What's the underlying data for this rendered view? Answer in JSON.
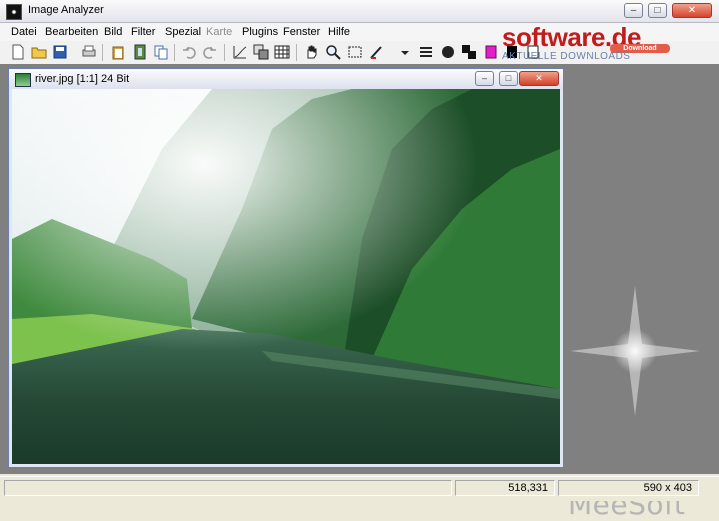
{
  "window": {
    "title": "Image Analyzer"
  },
  "menu": [
    "Datei",
    "Bearbeiten",
    "Bild",
    "Filter",
    "Spezial",
    "Karte",
    "Plugins",
    "Fenster",
    "Hilfe"
  ],
  "menu_disabled": [
    "Karte"
  ],
  "toolbar_icons": [
    "new-icon",
    "open-icon",
    "save-icon",
    "scanner-icon",
    "paste-icon",
    "film-icon",
    "copy-icon",
    "undo-icon",
    "redo-icon",
    "curve-icon",
    "layers-icon",
    "grid-icon",
    "hand-icon",
    "zoom-icon",
    "select-icon",
    "brush-icon",
    "dropdown-icon",
    "lines-icon",
    "dot-icon",
    "color-icon",
    "magenta-icon",
    "black-icon",
    "white-icon"
  ],
  "watermark": {
    "word": "software.de",
    "sub": "AKTUELLE DOWNLOADS",
    "badge": "Download"
  },
  "child": {
    "title": "river.jpg [1:1] 24 Bit"
  },
  "background_logo": "MeeSoft",
  "status": {
    "coords": "518,331",
    "size": "590 x 403"
  },
  "colors": {
    "sky": "#e6eef2",
    "forest": "#1f5c2a",
    "water": "#2f5a3f",
    "workspace": "#808080"
  }
}
